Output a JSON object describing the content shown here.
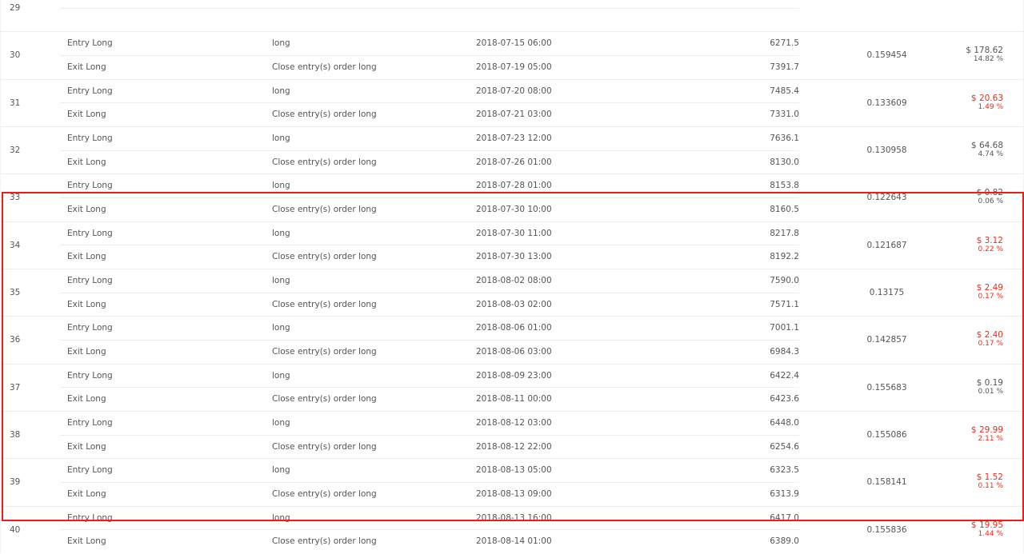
{
  "trades": [
    {
      "num": "29",
      "entry": {
        "type": "",
        "signal": "",
        "date": "",
        "price": ""
      },
      "exit": {
        "type": "",
        "signal": "",
        "date": "",
        "price": ""
      },
      "contracts": "",
      "profit": {
        "amount": "",
        "percent": "",
        "negative": false
      }
    },
    {
      "num": "30",
      "entry": {
        "type": "Entry Long",
        "signal": "long",
        "date": "2018-07-15 06:00",
        "price": "6271.5"
      },
      "exit": {
        "type": "Exit Long",
        "signal": "Close entry(s) order long",
        "date": "2018-07-19 05:00",
        "price": "7391.7"
      },
      "contracts": "0.159454",
      "profit": {
        "amount": "$ 178.62",
        "percent": "14.82 %",
        "negative": false
      }
    },
    {
      "num": "31",
      "entry": {
        "type": "Entry Long",
        "signal": "long",
        "date": "2018-07-20 08:00",
        "price": "7485.4"
      },
      "exit": {
        "type": "Exit Long",
        "signal": "Close entry(s) order long",
        "date": "2018-07-21 03:00",
        "price": "7331.0"
      },
      "contracts": "0.133609",
      "profit": {
        "amount": "$ 20.63",
        "percent": "1.49 %",
        "negative": true
      }
    },
    {
      "num": "32",
      "entry": {
        "type": "Entry Long",
        "signal": "long",
        "date": "2018-07-23 12:00",
        "price": "7636.1"
      },
      "exit": {
        "type": "Exit Long",
        "signal": "Close entry(s) order long",
        "date": "2018-07-26 01:00",
        "price": "8130.0"
      },
      "contracts": "0.130958",
      "profit": {
        "amount": "$ 64.68",
        "percent": "4.74 %",
        "negative": false
      }
    },
    {
      "num": "33",
      "entry": {
        "type": "Entry Long",
        "signal": "long",
        "date": "2018-07-28 01:00",
        "price": "8153.8"
      },
      "exit": {
        "type": "Exit Long",
        "signal": "Close entry(s) order long",
        "date": "2018-07-30 10:00",
        "price": "8160.5"
      },
      "contracts": "0.122643",
      "profit": {
        "amount": "$ 0.82",
        "percent": "0.06 %",
        "negative": false
      }
    },
    {
      "num": "34",
      "entry": {
        "type": "Entry Long",
        "signal": "long",
        "date": "2018-07-30 11:00",
        "price": "8217.8"
      },
      "exit": {
        "type": "Exit Long",
        "signal": "Close entry(s) order long",
        "date": "2018-07-30 13:00",
        "price": "8192.2"
      },
      "contracts": "0.121687",
      "profit": {
        "amount": "$ 3.12",
        "percent": "0.22 %",
        "negative": true
      }
    },
    {
      "num": "35",
      "entry": {
        "type": "Entry Long",
        "signal": "long",
        "date": "2018-08-02 08:00",
        "price": "7590.0"
      },
      "exit": {
        "type": "Exit Long",
        "signal": "Close entry(s) order long",
        "date": "2018-08-03 02:00",
        "price": "7571.1"
      },
      "contracts": "0.13175",
      "profit": {
        "amount": "$ 2.49",
        "percent": "0.17 %",
        "negative": true
      }
    },
    {
      "num": "36",
      "entry": {
        "type": "Entry Long",
        "signal": "long",
        "date": "2018-08-06 01:00",
        "price": "7001.1"
      },
      "exit": {
        "type": "Exit Long",
        "signal": "Close entry(s) order long",
        "date": "2018-08-06 03:00",
        "price": "6984.3"
      },
      "contracts": "0.142857",
      "profit": {
        "amount": "$ 2.40",
        "percent": "0.17 %",
        "negative": true
      }
    },
    {
      "num": "37",
      "entry": {
        "type": "Entry Long",
        "signal": "long",
        "date": "2018-08-09 23:00",
        "price": "6422.4"
      },
      "exit": {
        "type": "Exit Long",
        "signal": "Close entry(s) order long",
        "date": "2018-08-11 00:00",
        "price": "6423.6"
      },
      "contracts": "0.155683",
      "profit": {
        "amount": "$ 0.19",
        "percent": "0.01 %",
        "negative": false
      }
    },
    {
      "num": "38",
      "entry": {
        "type": "Entry Long",
        "signal": "long",
        "date": "2018-08-12 03:00",
        "price": "6448.0"
      },
      "exit": {
        "type": "Exit Long",
        "signal": "Close entry(s) order long",
        "date": "2018-08-12 22:00",
        "price": "6254.6"
      },
      "contracts": "0.155086",
      "profit": {
        "amount": "$ 29.99",
        "percent": "2.11 %",
        "negative": true
      }
    },
    {
      "num": "39",
      "entry": {
        "type": "Entry Long",
        "signal": "long",
        "date": "2018-08-13 05:00",
        "price": "6323.5"
      },
      "exit": {
        "type": "Exit Long",
        "signal": "Close entry(s) order long",
        "date": "2018-08-13 09:00",
        "price": "6313.9"
      },
      "contracts": "0.158141",
      "profit": {
        "amount": "$ 1.52",
        "percent": "0.11 %",
        "negative": true
      }
    },
    {
      "num": "40",
      "entry": {
        "type": "Entry Long",
        "signal": "long",
        "date": "2018-08-13 16:00",
        "price": "6417.0"
      },
      "exit": {
        "type": "Exit Long",
        "signal": "Close entry(s) order long",
        "date": "2018-08-14 01:00",
        "price": "6389.0"
      },
      "contracts": "0.155836",
      "profit": {
        "amount": "$ 19.95",
        "percent": "1.44 %",
        "negative": true
      }
    }
  ],
  "colors": {
    "negative": "#e0301e",
    "neutral": "#555555",
    "highlight": "#ee1c1c"
  }
}
